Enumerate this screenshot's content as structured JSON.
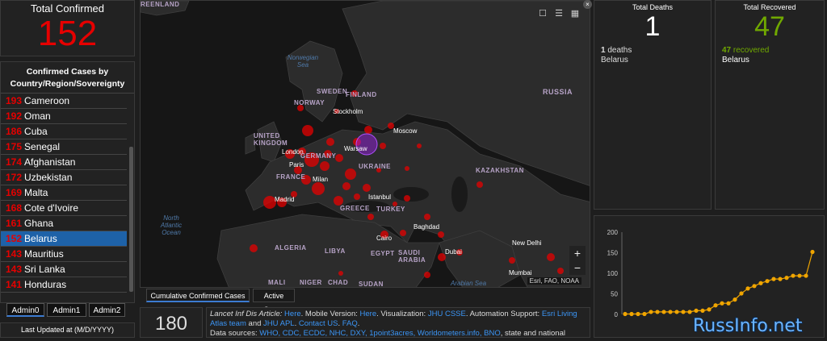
{
  "total_confirmed": {
    "title": "Total Confirmed",
    "value": "152"
  },
  "list": {
    "header": "Confirmed Cases by Country/Region/Sovereignty",
    "rows": [
      {
        "n": "193",
        "name": "Cameroon"
      },
      {
        "n": "192",
        "name": "Oman"
      },
      {
        "n": "186",
        "name": "Cuba"
      },
      {
        "n": "175",
        "name": "Senegal"
      },
      {
        "n": "174",
        "name": "Afghanistan"
      },
      {
        "n": "172",
        "name": "Uzbekistan"
      },
      {
        "n": "169",
        "name": "Malta"
      },
      {
        "n": "168",
        "name": "Cote d'Ivoire"
      },
      {
        "n": "161",
        "name": "Ghana"
      },
      {
        "n": "152",
        "name": "Belarus"
      },
      {
        "n": "143",
        "name": "Mauritius"
      },
      {
        "n": "143",
        "name": "Sri Lanka"
      },
      {
        "n": "141",
        "name": "Honduras"
      }
    ]
  },
  "admin_tabs": [
    "Admin0",
    "Admin1",
    "Admin2"
  ],
  "updated": {
    "label": "Last Updated at (M/D/YYYY)"
  },
  "map": {
    "labels": {
      "greenland": "REENLAND",
      "norwegian_sea": "Norwegian Sea",
      "sweden": "SWEDEN",
      "finland": "FINLAND",
      "norway": "NORWAY",
      "stockholm": "Stockholm",
      "russia": "RUSSIA",
      "moscow": "Moscow",
      "uk": "UNITED KINGDOM",
      "london": "London",
      "warsaw": "Warsaw",
      "germany": "GERMANY",
      "paris": "Paris",
      "ukraine": "UKRAINE",
      "kazakhstan": "KAZAKHSTAN",
      "france": "FRANCE",
      "milan": "Milan",
      "madrid": "Madrid",
      "istanbul": "Istanbul",
      "greece": "GREECE",
      "turkey": "TURKEY",
      "atlantic": "North Atlantic Ocean",
      "baghdad": "Baghdad",
      "algeria": "ALGERIA",
      "libya": "LIBYA",
      "egypt": "EGYPT",
      "cairo": "Cairo",
      "saudi": "SAUDI ARABIA",
      "dubai": "Dubai",
      "new_delhi": "New Delhi",
      "mumbai": "Mumbai",
      "arabian_sea": "Arabian Sea",
      "mali": "MALI",
      "niger": "NIGER",
      "chad": "CHAD",
      "sudan": "SUDAN"
    },
    "attribution": "Esri, FAO, NOAA",
    "tabs": [
      "Cumulative Confirmed Cases",
      "Active Cases"
    ]
  },
  "countries_count": "180",
  "info": {
    "l1a": "Lancet Inf Dis Article: ",
    "l1b": "Here",
    "l1c": ". Mobile Version: ",
    "l1d": "Here",
    "l1e": ". Visualization: ",
    "l1f": "JHU CSSE",
    "l1g": ". Automation Support: ",
    "l1h": "Esri Living",
    "l2a": "Atlas team",
    "l2b": " and ",
    "l2c": "JHU APL",
    "l2d": ". ",
    "l2e": "Contact US",
    "l2f": ". ",
    "l2g": "FAQ",
    "l2h": ".",
    "l3a": "Data sources: ",
    "l3b": "WHO, CDC, ECDC, NHC, DXY, 1point3acres, Worldometers.info, BNO",
    "l3c": ", state and national"
  },
  "deaths": {
    "title": "Total Deaths",
    "value": "1",
    "detail_num": "1",
    "detail_label": " deaths",
    "country": "Belarus"
  },
  "recovered": {
    "title": "Total Recovered",
    "value": "47",
    "detail_num": "47",
    "detail_label": " recovered",
    "country": "Belarus"
  },
  "colors": {
    "confirmed": "#e60000",
    "recovered": "#70a800",
    "selected": "#1e62a8",
    "chart_line": "#f0a500"
  },
  "chart_data": {
    "type": "line",
    "y_ticks": [
      "0",
      "50",
      "100",
      "150",
      "200"
    ],
    "ylim": [
      0,
      200
    ],
    "x": [
      1,
      2,
      3,
      4,
      5,
      6,
      7,
      8,
      9,
      10,
      11,
      12,
      13,
      14,
      15,
      16,
      17,
      18,
      19,
      20,
      21,
      22,
      23,
      24,
      25,
      26,
      27,
      28,
      29,
      30,
      31
    ],
    "values": [
      1,
      1,
      1,
      1,
      6,
      6,
      6,
      6,
      6,
      6,
      6,
      9,
      9,
      12,
      22,
      27,
      27,
      36,
      51,
      63,
      69,
      76,
      81,
      86,
      86,
      89,
      94,
      94,
      94,
      152
    ],
    "grid": false,
    "legend": "none"
  },
  "watermark": "RussInfo.net"
}
